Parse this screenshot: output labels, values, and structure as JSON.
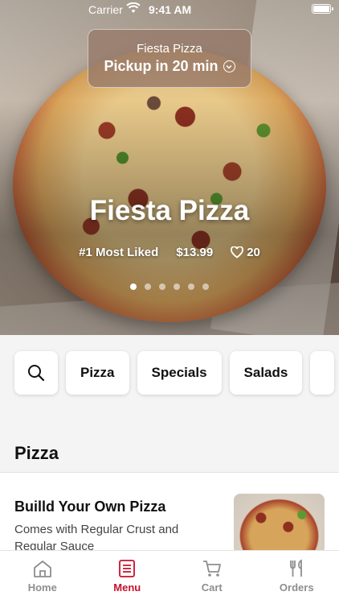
{
  "status_bar": {
    "carrier": "Carrier",
    "time": "9:41 AM"
  },
  "hero": {
    "store_name": "Fiesta Pizza",
    "pickup_text": "Pickup in 20 min",
    "title": "Fiesta Pizza",
    "rank": "#1 Most Liked",
    "price": "$13.99",
    "likes": "20",
    "carousel_count": 6,
    "carousel_active": 0
  },
  "chips": {
    "items": [
      "Pizza",
      "Specials",
      "Salads"
    ]
  },
  "section": {
    "title": "Pizza"
  },
  "menu_item": {
    "name": "Builld Your Own Pizza",
    "description": "Comes with Regular Crust and Regular Sauce"
  },
  "tabs": [
    {
      "label": "Home",
      "icon": "home-icon"
    },
    {
      "label": "Menu",
      "icon": "menu-icon"
    },
    {
      "label": "Cart",
      "icon": "cart-icon"
    },
    {
      "label": "Orders",
      "icon": "orders-icon"
    }
  ],
  "colors": {
    "accent": "#c8102e",
    "inactive": "#8e8e8e"
  }
}
